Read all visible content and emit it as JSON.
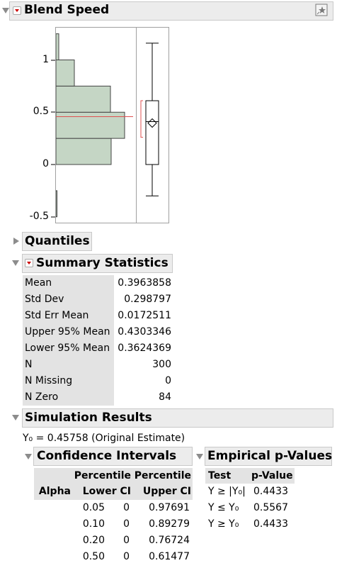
{
  "blend_speed": {
    "title": "Blend Speed",
    "y_ticks": [
      "1",
      "0.5",
      "0",
      "-0.5"
    ],
    "histogram_bins": [
      {
        "lo": -0.5,
        "hi": -0.25,
        "rel_freq": 0.01
      },
      {
        "lo": 0.0,
        "hi": 0.25,
        "rel_freq": 0.78
      },
      {
        "lo": 0.25,
        "hi": 0.5,
        "rel_freq": 0.97
      },
      {
        "lo": 0.5,
        "hi": 0.75,
        "rel_freq": 0.77
      },
      {
        "lo": 0.75,
        "hi": 1.0,
        "rel_freq": 0.26
      },
      {
        "lo": 1.0,
        "hi": 1.25,
        "rel_freq": 0.04
      }
    ],
    "box_plot": {
      "min": -0.3,
      "q1": 0.0,
      "median": 0.41,
      "q3": 0.61,
      "max": 1.16,
      "mean": 0.3963858,
      "ci_lower": 0.3624369,
      "ci_upper": 0.4303346
    },
    "reference_line_value": 0.45758,
    "colors": {
      "bar_fill": "#c5d6c5",
      "bar_stroke": "#444444",
      "ref_line": "#e05050"
    },
    "icon": "star-pin-icon"
  },
  "quantiles": {
    "title": "Quantiles"
  },
  "summary_statistics": {
    "title": "Summary Statistics",
    "rows": [
      {
        "label": "Mean",
        "value": "0.3963858"
      },
      {
        "label": "Std Dev",
        "value": "0.298797"
      },
      {
        "label": "Std Err Mean",
        "value": "0.0172511"
      },
      {
        "label": "Upper 95% Mean",
        "value": "0.4303346"
      },
      {
        "label": "Lower 95% Mean",
        "value": "0.3624369"
      },
      {
        "label": "N",
        "value": "300"
      },
      {
        "label": "N Missing",
        "value": "0"
      },
      {
        "label": "N Zero",
        "value": "84"
      }
    ]
  },
  "simulation_results": {
    "title": "Simulation Results",
    "y0_text": "Y₀ = 0.45758 (Original Estimate)",
    "confidence_intervals": {
      "title": "Confidence Intervals",
      "headers": {
        "alpha": "Alpha",
        "lower_top": "Percentile",
        "lower_bottom": "Lower CI",
        "upper_top": "Percentile",
        "upper_bottom": "Upper CI"
      },
      "rows": [
        {
          "alpha": "0.05",
          "lower": "0",
          "upper": "0.97691"
        },
        {
          "alpha": "0.10",
          "lower": "0",
          "upper": "0.89279"
        },
        {
          "alpha": "0.20",
          "lower": "0",
          "upper": "0.76724"
        },
        {
          "alpha": "0.50",
          "lower": "0",
          "upper": "0.61477"
        }
      ]
    },
    "empirical_p_values": {
      "title": "Empirical p-Values",
      "headers": {
        "test": "Test",
        "p_value": "p-Value"
      },
      "rows": [
        {
          "test": "Y ≥ |Y₀|",
          "p": "0.4433"
        },
        {
          "test": "Y ≤ Y₀",
          "p": "0.5567"
        },
        {
          "test": "Y ≥ Y₀",
          "p": "0.4433"
        }
      ]
    }
  }
}
